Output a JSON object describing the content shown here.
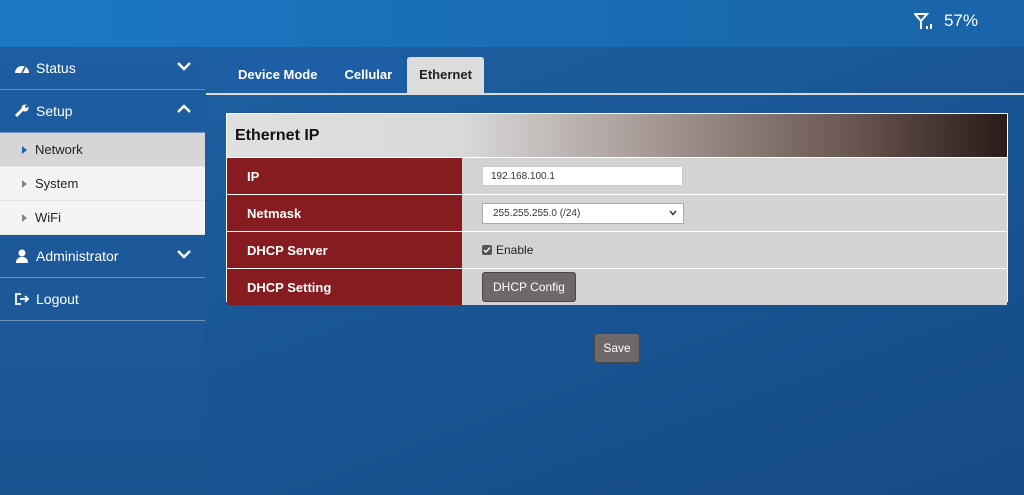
{
  "status_bar": {
    "signal_percent": "57%",
    "signal_icon": "signal-icon"
  },
  "sidebar": {
    "status_label": "Status",
    "setup_label": "Setup",
    "setup_items": [
      {
        "label": "Network",
        "active": true
      },
      {
        "label": "System",
        "active": false
      },
      {
        "label": "WiFi",
        "active": false
      }
    ],
    "administrator_label": "Administrator",
    "logout_label": "Logout"
  },
  "tabs": [
    {
      "label": "Device Mode",
      "active": false
    },
    {
      "label": "Cellular",
      "active": false
    },
    {
      "label": "Ethernet",
      "active": true
    }
  ],
  "panel": {
    "title": "Ethernet IP",
    "rows": {
      "ip": {
        "label": "IP",
        "value": "192.168.100.1"
      },
      "netmask": {
        "label": "Netmask",
        "value": "255.255.255.0 (/24)"
      },
      "dhcp_server": {
        "label": "DHCP Server",
        "checkbox_label": "Enable",
        "checked": true
      },
      "dhcp_setting": {
        "label": "DHCP Setting",
        "button_label": "DHCP Config"
      }
    }
  },
  "save_label": "Save",
  "colors": {
    "accent": "#1e5ea6",
    "label_red": "#861c20",
    "button_gray": "#6e6868"
  }
}
